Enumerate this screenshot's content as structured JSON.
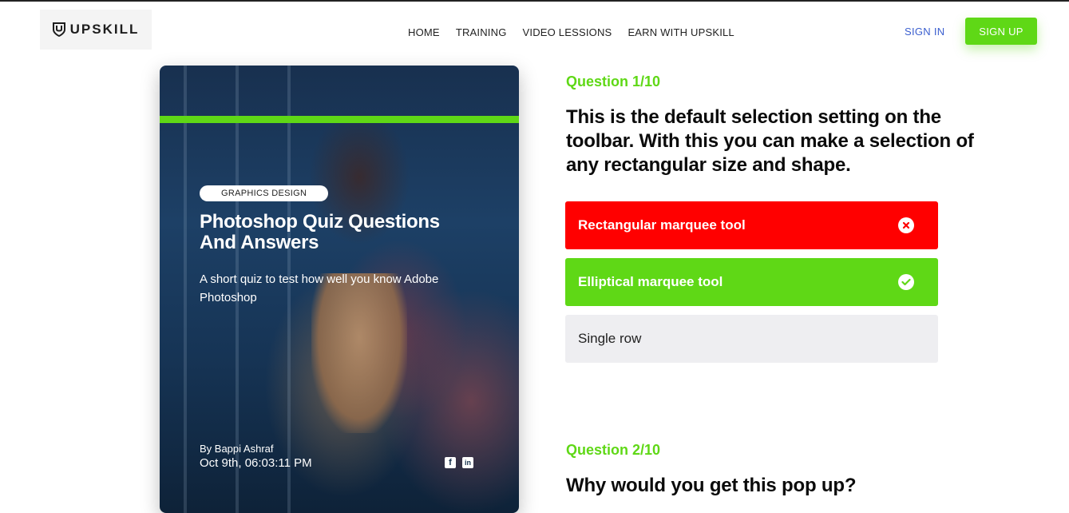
{
  "header": {
    "logo_text": "UPSKILL",
    "nav": [
      "HOME",
      "TRAINING",
      "VIDEO LESSIONS",
      "EARN WITH UPSKILL"
    ],
    "sign_in": "SIGN IN",
    "sign_up": "SIGN UP"
  },
  "card": {
    "tag": "GRAPHICS DESIGN",
    "title": "Photoshop Quiz Questions And Answers",
    "description": "A short quiz to test how well you know Adobe Photoshop",
    "author": "By Bappi Ashraf",
    "date": "Oct 9th, 06:03:11 PM",
    "social_icons": [
      "facebook-icon",
      "linkedin-icon"
    ]
  },
  "quiz": {
    "q1": {
      "label": "Question 1/10",
      "text": "This is the default selection setting on the toolbar. With this you can make a selection of any rectangular size and shape.",
      "answers": [
        {
          "label": "Rectangular marquee tool",
          "state": "wrong",
          "icon": "x-circle-icon"
        },
        {
          "label": "Elliptical marquee tool",
          "state": "correct",
          "icon": "check-circle-icon"
        },
        {
          "label": "Single row",
          "state": "unselected"
        }
      ]
    },
    "q2": {
      "label": "Question 2/10",
      "text": "Why would you get this pop up?"
    }
  },
  "colors": {
    "accent_green": "#5fd816",
    "wrong_red": "#ff0000",
    "link_blue": "#3b5fcf"
  }
}
